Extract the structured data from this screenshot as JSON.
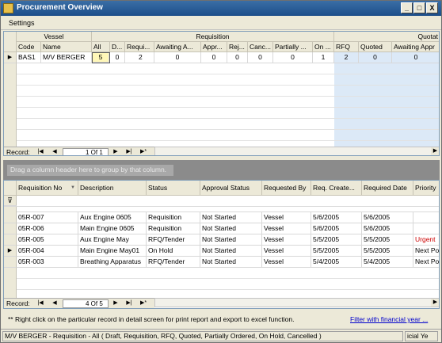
{
  "window": {
    "title": "Procurement Overview",
    "minimize": "_",
    "maximize": "□",
    "close": "X"
  },
  "menu": {
    "settings": "Settings"
  },
  "top_grid": {
    "group_headers": {
      "vessel": "Vessel",
      "requisition": "Requisition",
      "quoted": "Quotat"
    },
    "columns": [
      "Code",
      "Name",
      "All",
      "D...",
      "Requi...",
      "Awaiting A...",
      "Appr...",
      "Rej...",
      "Canc...",
      "Partially ...",
      "On ...",
      "RFQ",
      "Quoted",
      "Awaiting Appr"
    ],
    "row": [
      "BAS1",
      "M/V BERGER",
      "5",
      "0",
      "2",
      "0",
      "0",
      "0",
      "0",
      "0",
      "1",
      "2",
      "0",
      "0"
    ],
    "record_label": "Record:",
    "record_page": "1 Of 1"
  },
  "group_panel": {
    "hint": "Drag a column header here to group by that column."
  },
  "bottom_grid": {
    "columns": [
      "Requisition No",
      "Description",
      "Status",
      "Approval Status",
      "Requested By",
      "Req. Create...",
      "Required Date",
      "Priority"
    ],
    "rows": [
      [
        "05R-007",
        "Aux Engine 0605",
        "Requisition",
        "Not Started",
        "Vessel",
        "5/6/2005",
        "5/6/2005",
        ""
      ],
      [
        "05R-006",
        "Main Engine 0605",
        "Requisition",
        "Not Started",
        "Vessel",
        "5/6/2005",
        "5/6/2005",
        ""
      ],
      [
        "05R-005",
        "Aux Engine May",
        "RFQ/Tender",
        "Not Started",
        "Vessel",
        "5/5/2005",
        "5/5/2005",
        "Urgent"
      ],
      [
        "05R-004",
        "Main Engine May01",
        "On Hold",
        "Not Started",
        "Vessel",
        "5/5/2005",
        "5/5/2005",
        "Next Po"
      ],
      [
        "05R-003",
        "Breathing Apparatus",
        "RFQ/Tender",
        "Not Started",
        "Vessel",
        "5/4/2005",
        "5/4/2005",
        "Next Po"
      ]
    ],
    "record_label": "Record:",
    "record_page": "4 Of 5"
  },
  "footer": {
    "note": "** Right click on the particular record in detail screen for print report and export to excel function.",
    "link": "Filter with financial year ..."
  },
  "status": {
    "main": "M/V BERGER - Requisition - All ( Draft, Requisition, RFQ, Quoted, Partially Ordered, On Hold, Cancelled )",
    "side": "icial Ye"
  },
  "colors": {
    "title_bar": "#1c4e8a",
    "urgent": "#cc0000",
    "link": "#0000cc",
    "quote_col": "#dce9f7"
  }
}
